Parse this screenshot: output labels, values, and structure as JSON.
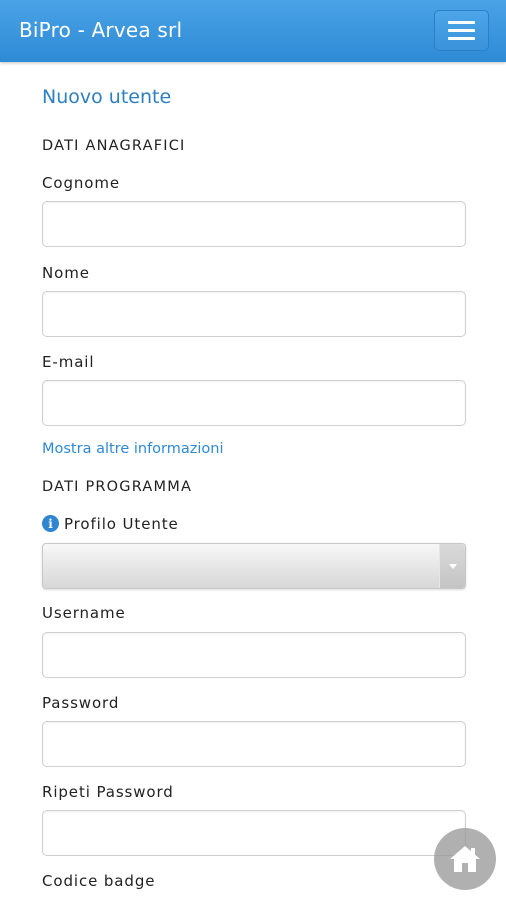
{
  "app": {
    "title": "BiPro - Arvea srl"
  },
  "navbar": {
    "menu_icon": "hamburger-menu-icon"
  },
  "page": {
    "title": "Nuovo utente"
  },
  "sections": {
    "anagrafici": "DATI ANAGRAFICI",
    "programma": "DATI PROGRAMMA"
  },
  "fields": {
    "cognome": {
      "label": "Cognome",
      "value": ""
    },
    "nome": {
      "label": "Nome",
      "value": ""
    },
    "email": {
      "label": "E-mail",
      "value": ""
    },
    "profilo": {
      "label": "Profilo Utente",
      "value": "",
      "icon": "info-icon"
    },
    "username": {
      "label": "Username",
      "value": ""
    },
    "password": {
      "label": "Password",
      "value": ""
    },
    "ripeti_password": {
      "label": "Ripeti Password",
      "value": ""
    },
    "codice_badge": {
      "label": "Codice badge"
    }
  },
  "links": {
    "more_info": "Mostra altre informazioni"
  },
  "floating": {
    "home_icon": "home-icon"
  },
  "colors": {
    "navbar": "#3b96de",
    "accent": "#2f8ad6",
    "title": "#2d7fbf"
  }
}
